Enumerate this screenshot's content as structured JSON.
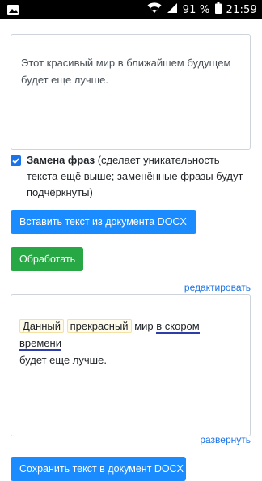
{
  "status_bar": {
    "battery": "91 %",
    "time": "21:59"
  },
  "input": {
    "text": "Этот красивый мир в ближайшем будущем будет еще лучше."
  },
  "replace_option": {
    "checked": true,
    "title": "Замена фраз",
    "description": " (сделает уникательность текста ещё выше; заменённые фразы будут подчёркнуты)"
  },
  "buttons": {
    "insert_docx": "Вставить текст из документа DOCX",
    "process": "Обработать",
    "save_docx": "Сохранить текст в документ DOCX"
  },
  "links": {
    "edit": "редактировать",
    "expand": "развернуть"
  },
  "output": {
    "word1": "Данный",
    "word2": "прекрасный",
    "word3": "мир",
    "phrase": "в скором времени",
    "rest": "будет еще лучше."
  }
}
